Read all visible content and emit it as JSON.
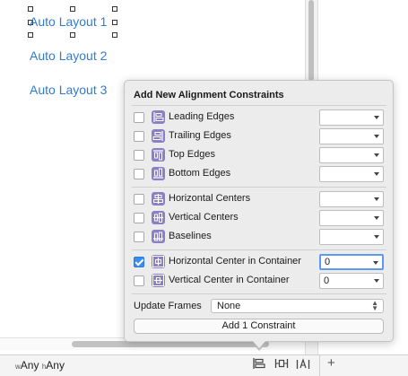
{
  "canvas": {
    "labels": [
      "Auto Layout 1",
      "Auto Layout 2",
      "Auto Layout 3"
    ]
  },
  "bottom_bar": {
    "width_class_prefix": "w",
    "width_class": "Any",
    "height_class_prefix": "h",
    "height_class": "Any",
    "icons": [
      "align-icon",
      "pin-icon",
      "resolve-issues-icon"
    ],
    "add_label": "+"
  },
  "popover": {
    "title": "Add New Alignment Constraints",
    "groups": [
      [
        {
          "label": "Leading Edges",
          "checked": false,
          "value": ""
        },
        {
          "label": "Trailing Edges",
          "checked": false,
          "value": ""
        },
        {
          "label": "Top Edges",
          "checked": false,
          "value": ""
        },
        {
          "label": "Bottom Edges",
          "checked": false,
          "value": ""
        }
      ],
      [
        {
          "label": "Horizontal Centers",
          "checked": false,
          "value": ""
        },
        {
          "label": "Vertical Centers",
          "checked": false,
          "value": ""
        },
        {
          "label": "Baselines",
          "checked": false,
          "value": ""
        }
      ],
      [
        {
          "label": "Horizontal Center in Container",
          "checked": true,
          "value": "0"
        },
        {
          "label": "Vertical Center in Container",
          "checked": false,
          "value": "0"
        }
      ]
    ],
    "update_frames_label": "Update Frames",
    "update_frames_value": "None",
    "add_button_label": "Add 1 Constraint"
  },
  "colors": {
    "accent": "#3b8ef0",
    "label_blue": "#2f7bd6",
    "constraint_icon": "#8c7fc5"
  }
}
